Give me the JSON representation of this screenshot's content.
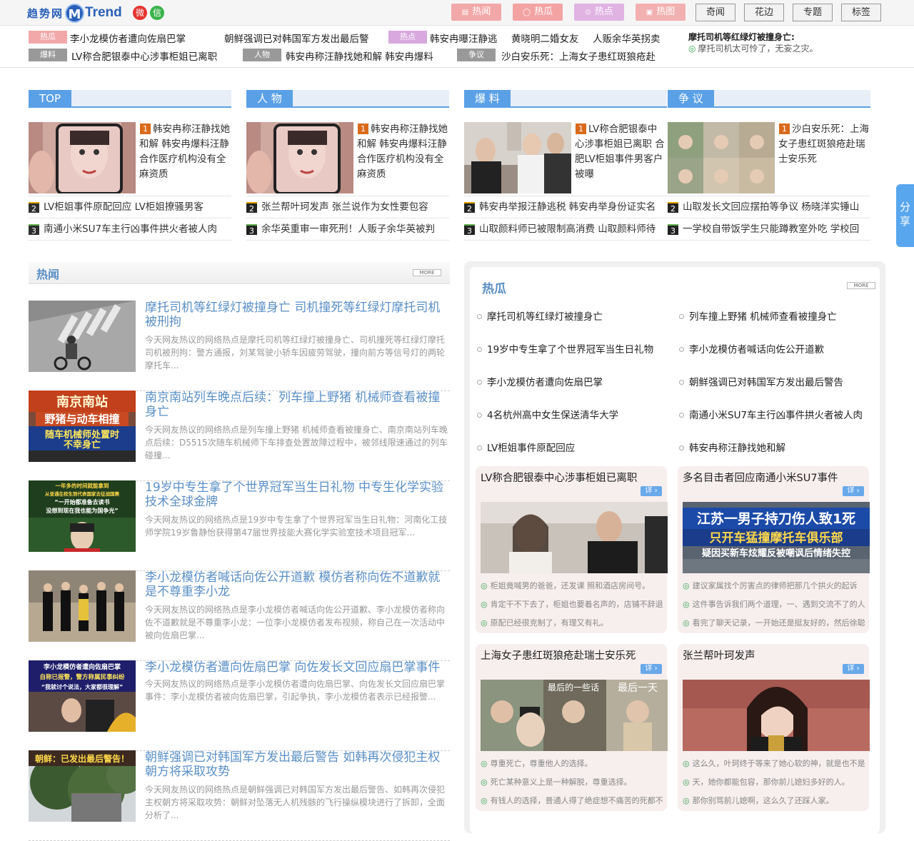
{
  "logo": {
    "cn": "趋势网",
    "m": "M",
    "en": "Trend"
  },
  "social": {
    "weibo": "微",
    "wechat": "信"
  },
  "cat_buttons": [
    {
      "label": "热闻",
      "color": "#f2a8a8"
    },
    {
      "label": "热瓜",
      "color": "#f4a3a3"
    },
    {
      "label": "热点",
      "color": "#e0b3e3"
    },
    {
      "label": "热图",
      "color": "#f2b0b0"
    }
  ],
  "nav_buttons": [
    "奇闻",
    "花边",
    "专题",
    "标签"
  ],
  "ticker": {
    "rows": [
      {
        "tag": "热瓜",
        "tag_color": "#f2a8a8",
        "text": "李小龙模仿者遭向佐扇巴掌",
        "extra": "朝鲜强调已对韩国军方发出最后警",
        "tag2": "热点",
        "tag2_color": "#d8a8de",
        "text2": "韩安冉曝汪静逃",
        "extra2": "黄晓明二婚女友",
        "extra3": "人贩余华英拐卖"
      },
      {
        "tag": "爆料",
        "tag_color": "#999999",
        "text": "LV称合肥银泰中心涉事柜姐已离职",
        "extra": "",
        "tag2": "人物",
        "tag2_color": "#999999",
        "text2": "韩安冉称汪静找她和解 韩安冉爆料",
        "tag3": "争议",
        "tag3_color": "#999999",
        "text3": "沙白安乐死：上海女子患红斑狼疮赴"
      }
    ],
    "headline": "摩托司机等红绿灯被撞身亡:",
    "sub": "摩托司机太可怜了，无妄之灾。"
  },
  "columns": [
    {
      "title": "TOP",
      "feature": {
        "rank": "1",
        "title": "韩安冉称汪静找她和解 韩安冉爆料汪静合作医疗机构没有全麻资质"
      },
      "items": [
        {
          "rank": "2",
          "text": "LV柜姐事件原配回应 LV柜姐撩骚男客"
        },
        {
          "rank": "3",
          "text": "南通小米SU7车主行凶事件拱火者被人肉"
        }
      ]
    },
    {
      "title": "人 物",
      "feature": {
        "rank": "1",
        "title": "韩安冉称汪静找她和解 韩安冉爆料汪静合作医疗机构没有全麻资质"
      },
      "items": [
        {
          "rank": "2",
          "text": "张兰帮叶珂发声 张兰说作为女性要包容"
        },
        {
          "rank": "3",
          "text": "余华英重审一审死刑！人贩子余华英被判"
        }
      ]
    },
    {
      "title": "爆 料",
      "feature": {
        "rank": "1",
        "title": "LV称合肥银泰中心涉事柜姐已离职 合肥LV柜姐事件男客户被曝"
      },
      "items": [
        {
          "rank": "2",
          "text": "韩安冉举报汪静逃税 韩安冉举身份证实名"
        },
        {
          "rank": "3",
          "text": "山取颜料师已被限制高消费 山取颜料师待"
        }
      ]
    },
    {
      "title": "争 议",
      "feature": {
        "rank": "1",
        "title": "沙白安乐死：上海女子患红斑狼疮赴瑞士安乐死"
      },
      "items": [
        {
          "rank": "2",
          "text": "山取发长文回应摆拍等争议 杨晓洋实锤山"
        },
        {
          "rank": "3",
          "text": "一学校自带饭学生只能蹲教室外吃 学校回"
        }
      ]
    }
  ],
  "hotnews": {
    "title": "热闻",
    "more": "MORE",
    "items": [
      {
        "title": "摩托司机等红绿灯被撞身亡 司机撞死等红绿灯摩托司机被刑拘",
        "desc": "今天网友热议的网络热点是摩托司机等红绿灯被撞身亡、司机撞死等红绿灯摩托司机被刑拘：警方通报，刘某驾驶小轿车因疲劳驾驶，撞向前方等信号灯的两轮摩托车...",
        "img": "road"
      },
      {
        "title": "南京南站列车晚点后续：列车撞上野猪 机械师查看被撞身亡",
        "desc": "今天网友热议的网络热点是列车撞上野猪 机械师查看被撞身亡、南京南站列车晚点后续：D5515次随车机械师下车排查处置故障过程中，被邻线限速通过的列车碰撞...",
        "img": "train",
        "overlay": [
          "南京南站",
          "野猪与动车相撞",
          "随车机械师处置时",
          "不幸身亡"
        ]
      },
      {
        "title": "19岁中专生拿了个世界冠军当生日礼物 中专生化学实验技术全球金牌",
        "desc": "今天网友热议的网络热点是19岁中专生拿了个世界冠军当生日礼物：河南化工技师学院19岁鲁静怡获得第47届世界技能大赛化学实验室技术项目冠军...",
        "img": "student",
        "overlay": [
          "一年多的时间就能拿到",
          "从普通在校生到代表国家去征战国赛",
          "“一开始都准备去读书",
          "没想到现在我也能为国争光”"
        ]
      },
      {
        "title": "李小龙模仿者喊话向佐公开道歉 模仿者称向佐不道歉就是不尊重李小龙",
        "desc": "今天网友热议的网络热点是李小龙模仿者喊话向佐公开道歉、李小龙模仿者称向佐不道歉就是不尊重李小龙：一位李小龙模仿者发布视频，称自己在一次活动中被向佐扇巴掌...",
        "img": "crowd"
      },
      {
        "title": "李小龙模仿者遭向佐扇巴掌 向佐发长文回应扇巴掌事件",
        "desc": "今天网友热议的网络热点是李小龙模仿者遭向佐扇巴掌、向佐发长文回应扇巴掌事件：李小龙模仿者被向佐扇巴掌，引起争执，李小龙模仿者表示已经报警...",
        "img": "slap",
        "overlay": [
          "李小龙模仿者遭向佐扇巴掌",
          "自称已报警，警方称属民事纠纷",
          "“我就讨个说法，大家都很理解”"
        ]
      },
      {
        "title": "朝鲜强调已对韩国军方发出最后警告 如韩再次侵犯主权朝方将采取攻势",
        "desc": "今天网友热议的网络热点是朝鲜强调已对韩国军方发出最后警告、如韩再次侵犯主权朝方将采取攻势：朝鲜对坠落无人机残骸的飞行操纵模块进行了拆卸，全面分析了...",
        "img": "tree",
        "overlay": [
          "朝鲜：已发出最后警告！"
        ]
      }
    ]
  },
  "gua": {
    "title": "热瓜",
    "more": "MORE",
    "list": [
      "摩托司机等红绿灯被撞身亡",
      "列车撞上野猪 机械师查看被撞身亡",
      "19岁中专生拿了个世界冠军当生日礼物",
      "李小龙模仿者喊话向佐公开道歉",
      "李小龙模仿者遭向佐扇巴掌",
      "朝鲜强调已对韩国军方发出最后警告",
      "4名杭州高中女生保送清华大学",
      "南通小米SU7车主行凶事件拱火者被人肉",
      "LV柜姐事件原配回应",
      "韩安冉称汪静找她和解"
    ],
    "cards": [
      {
        "title": "LV称合肥银泰中心涉事柜姐已离职",
        "more": "详",
        "img": "lv",
        "comments": [
          "柜姐竟喊男的爸爸，还发课 照和酒店房间号。",
          "肯定干不下去了，柜姐也要着名声的，店铺不辞退",
          "原配已经很克制了，有理又有礼。"
        ]
      },
      {
        "title": "多名目击者回应南通小米SU7事件",
        "more": "详",
        "img": "su7",
        "overlay": [
          "江苏一男子持刀伤人致1死",
          "只开车猛撞摩托车俱乐部",
          "疑因买新车炫耀反被嘲讽后情绪失控"
        ],
        "comments": [
          "建议家属找个厉害点的律师把那几个拱火的起诉",
          "这件事告诉我们两个道理，一、遇到交流不了的人",
          "看完了聊天记录，一开始还是挺友好的，然后徐聪"
        ]
      },
      {
        "title": "上海女子患红斑狼疮赴瑞士安乐死",
        "more": "详",
        "img": "shabai",
        "overlay": [
          "最后的一些话",
          "最后一天"
        ],
        "comments": [
          "尊重死亡，尊重他人的选择。",
          "死亡某种意义上是一种解脱，尊重选择。",
          "有钱人的选择，普通人得了绝症想不痛苦的死都不"
        ]
      },
      {
        "title": "张兰帮叶珂发声",
        "more": "详",
        "img": "zhanglan",
        "comments": [
          "这么久，叶珂终于等来了她心软的神，就是也不是",
          "天，她你都能包容，那你前儿媳妇多好的人。",
          "那你别骂前儿媳啊，这么久了还踩人家。"
        ]
      }
    ]
  },
  "share": {
    "label": "分享"
  }
}
